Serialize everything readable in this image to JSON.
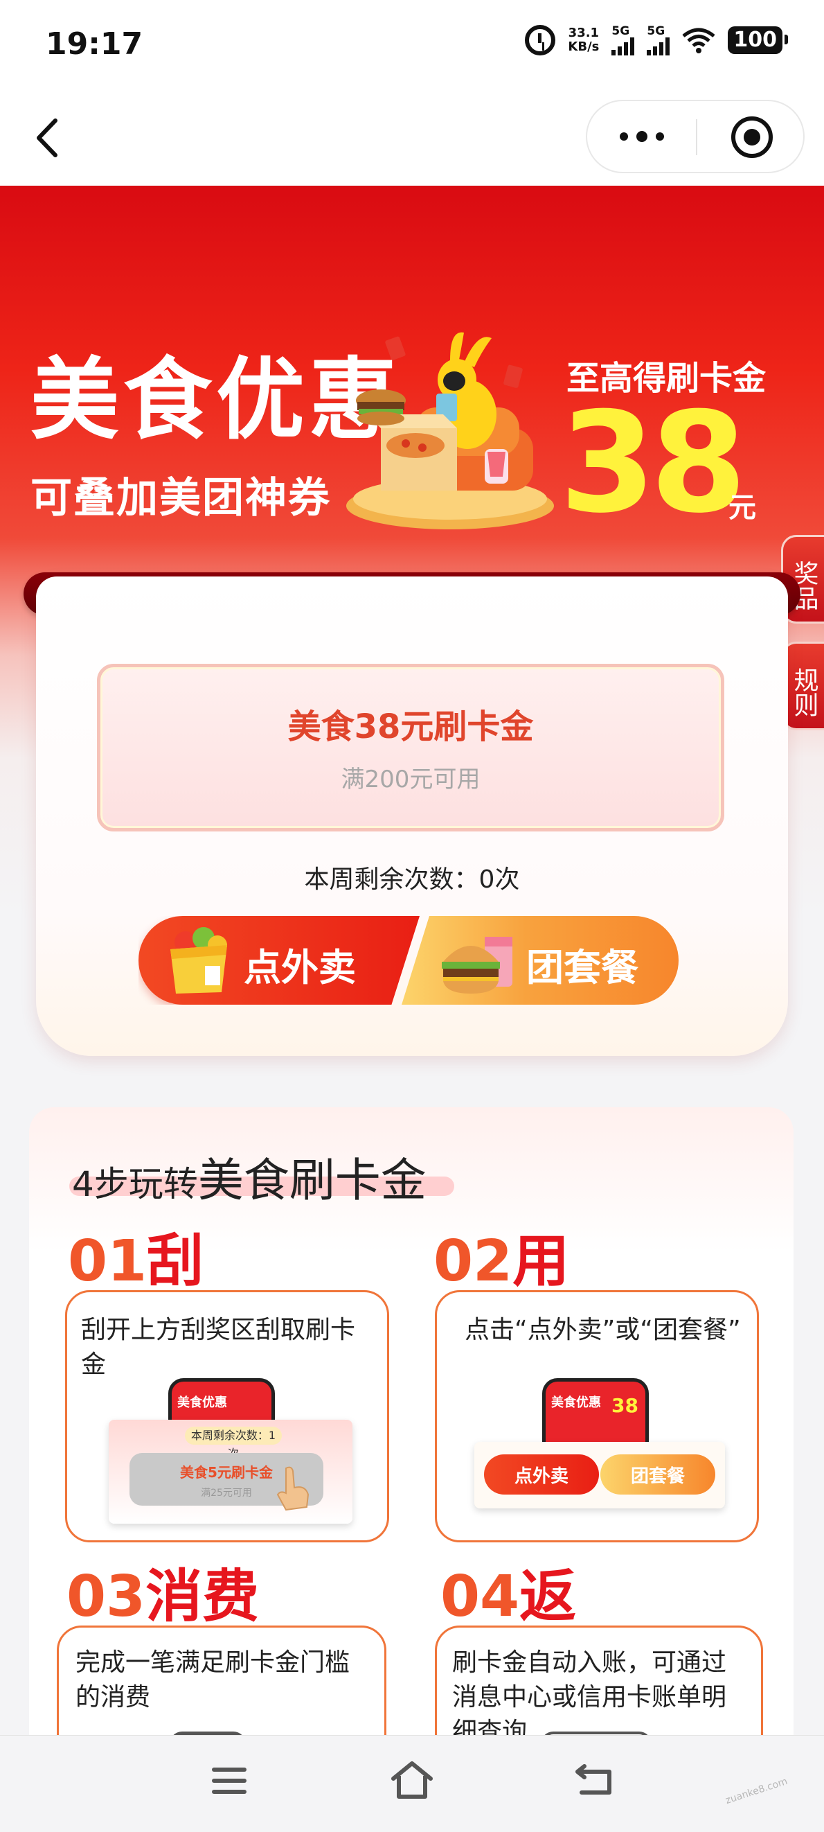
{
  "status_bar": {
    "time": "19:17",
    "network_speed": "33.1",
    "network_unit": "KB/s",
    "sim1": "5G",
    "sim2": "5G",
    "battery": "100"
  },
  "hero": {
    "title": "美食优惠",
    "subtitle": "可叠加美团神券",
    "prize_label": "至高得刷卡金",
    "prize_amount": "38",
    "prize_unit": "元",
    "side_tabs": [
      "奖品",
      "规则"
    ]
  },
  "card": {
    "coupon_title": "美食38元刷卡金",
    "coupon_condition": "满200元可用",
    "remaining_text": "本周剩余次数：0次",
    "buttons": [
      {
        "label": "点外卖",
        "icon": "grocery-bag-icon"
      },
      {
        "label": "团套餐",
        "icon": "burger-drink-icon"
      }
    ]
  },
  "steps": {
    "title_prefix": "4步玩转",
    "title_highlight": "美食刷卡金",
    "items": [
      {
        "num": "01",
        "word": "刮",
        "text": "刮开上方刮奖区刮取刷卡金",
        "mini_remaining": "本周剩余次数：1 次",
        "mini_coupon": "美食5元刷卡金",
        "mini_cond": "满25元可用",
        "mini_phone_title": "美食优惠"
      },
      {
        "num": "02",
        "word": "用",
        "text": "点击“点外卖”或“团套餐”",
        "mini_btn_1": "点外卖",
        "mini_btn_2": "团套餐",
        "mini_phone_title": "美食优惠",
        "mini_phone_amount": "38"
      },
      {
        "num": "03",
        "word": "消费",
        "text": "完成一笔满足刷卡金门槛的消费"
      },
      {
        "num": "04",
        "word": "返",
        "text": "刷卡金自动入账，可通过消息中心或信用卡账单明细查询"
      }
    ]
  },
  "watermark": "zuanke8.com",
  "colors": {
    "brand_red": "#e6161e",
    "accent_orange": "#f0562a",
    "prize_yellow": "#fff23c"
  }
}
